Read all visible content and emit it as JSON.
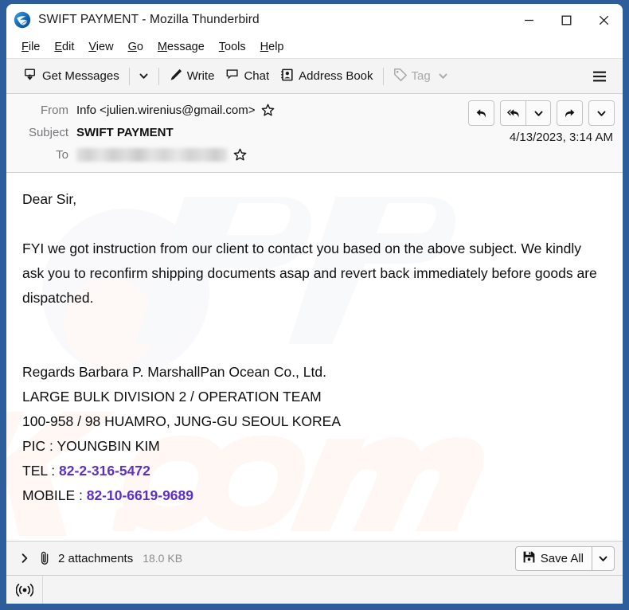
{
  "window": {
    "title": "SWIFT PAYMENT - Mozilla Thunderbird",
    "logo_icon": "thunderbird-logo-icon",
    "controls": {
      "minimize": "minimize-icon",
      "maximize": "maximize-icon",
      "close": "close-icon"
    }
  },
  "menubar": {
    "items": [
      {
        "label": "File",
        "accel": "F"
      },
      {
        "label": "Edit",
        "accel": "E"
      },
      {
        "label": "View",
        "accel": "V"
      },
      {
        "label": "Go",
        "accel": "G"
      },
      {
        "label": "Message",
        "accel": "M"
      },
      {
        "label": "Tools",
        "accel": "T"
      },
      {
        "label": "Help",
        "accel": "H"
      }
    ]
  },
  "toolbar": {
    "get_messages_label": "Get Messages",
    "get_messages_icon": "download-message-icon",
    "get_messages_caret_icon": "chevron-down-icon",
    "write_label": "Write",
    "write_icon": "pencil-icon",
    "chat_label": "Chat",
    "chat_icon": "chat-bubble-icon",
    "address_book_label": "Address Book",
    "address_book_icon": "address-book-icon",
    "tag_label": "Tag",
    "tag_icon": "tag-icon",
    "tag_caret_icon": "chevron-down-icon",
    "tag_disabled": true,
    "app_menu_icon": "hamburger-menu-icon"
  },
  "message_header": {
    "from_label": "From",
    "from_value": "Info <julien.wirenius@gmail.com>",
    "from_star_icon": "star-outline-icon",
    "subject_label": "Subject",
    "subject_value": "SWIFT PAYMENT",
    "to_label": "To",
    "to_value": "",
    "to_redacted": true,
    "to_star_icon": "star-outline-icon",
    "date": "4/13/2023, 3:14 AM",
    "actions": [
      {
        "name": "reply-button",
        "icon": "reply-arrow-icon"
      },
      {
        "name": "reply-all-button",
        "icon": "reply-all-arrow-icon"
      },
      {
        "name": "reply-all-dropdown",
        "icon": "chevron-down-icon"
      },
      {
        "name": "forward-button",
        "icon": "forward-arrow-icon"
      },
      {
        "name": "more-actions-dropdown",
        "icon": "chevron-down-icon"
      }
    ]
  },
  "message_body": {
    "greeting": "Dear Sir,",
    "paragraph": "FYI we got instruction from our client to contact you based on the above subject. We kindly ask you to reconfirm shipping documents asap and revert back immediately before goods are dispatched.",
    "signature": [
      "Regards Barbara P. MarshallPan Ocean Co., Ltd.",
      "LARGE BULK DIVISION 2 / OPERATION TEAM",
      "100-958 / 98 HUAMRO, JUNG-GU SEOUL KOREA",
      "PIC : YOUNGBIN KIM"
    ],
    "tel_label": "TEL : ",
    "tel_value": "82-2-316-5472",
    "mobile_label": "MOBILE : ",
    "mobile_value": "82-10-6619-9689",
    "watermark_text": "pcrisk.com",
    "link_color": "#5c30c7"
  },
  "attachments": {
    "expand_icon": "chevron-right-icon",
    "clip_icon": "paperclip-icon",
    "count_label": "2 attachments",
    "size_label": "18.0 KB",
    "save_all_label": "Save All",
    "save_all_icon": "save-disk-icon",
    "save_all_caret_icon": "chevron-down-icon"
  },
  "statusbar": {
    "connection_icon": "broadcast-signal-icon"
  },
  "colors": {
    "desktop_blue": "#2d5d9a",
    "toolbar_bg": "#f4f4f4",
    "header_bg": "#f9f9f9",
    "link_purple": "#5c30c7",
    "muted_text": "#76767a"
  }
}
